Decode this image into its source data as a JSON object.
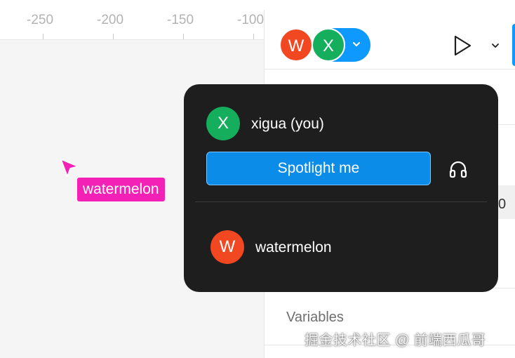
{
  "ruler": {
    "labels": [
      "-250",
      "-200",
      "-150",
      "-100"
    ]
  },
  "canvas": {
    "cursor": {
      "icon": "cursor-pointer-icon",
      "label": "watermelon",
      "color": "#F321B5"
    }
  },
  "header": {
    "avatars": [
      {
        "initial": "W",
        "color": "#F24822"
      },
      {
        "initial": "X",
        "color": "#14AE5C"
      }
    ],
    "multiplayer_pill_color": "#0D99FF",
    "play_icon": "play-icon",
    "chevron_icon": "chevron-down-icon"
  },
  "panel": {
    "edge_digit": "0",
    "variables_label": "Variables"
  },
  "popover": {
    "self": {
      "initial": "X",
      "name": "xigua (you)",
      "color": "#14AE5C"
    },
    "spotlight_label": "Spotlight me",
    "audio_icon": "headphones-icon",
    "others": [
      {
        "initial": "W",
        "name": "watermelon",
        "color": "#F24822"
      }
    ]
  },
  "watermark": "掘金技术社区 @ 前端西瓜哥"
}
